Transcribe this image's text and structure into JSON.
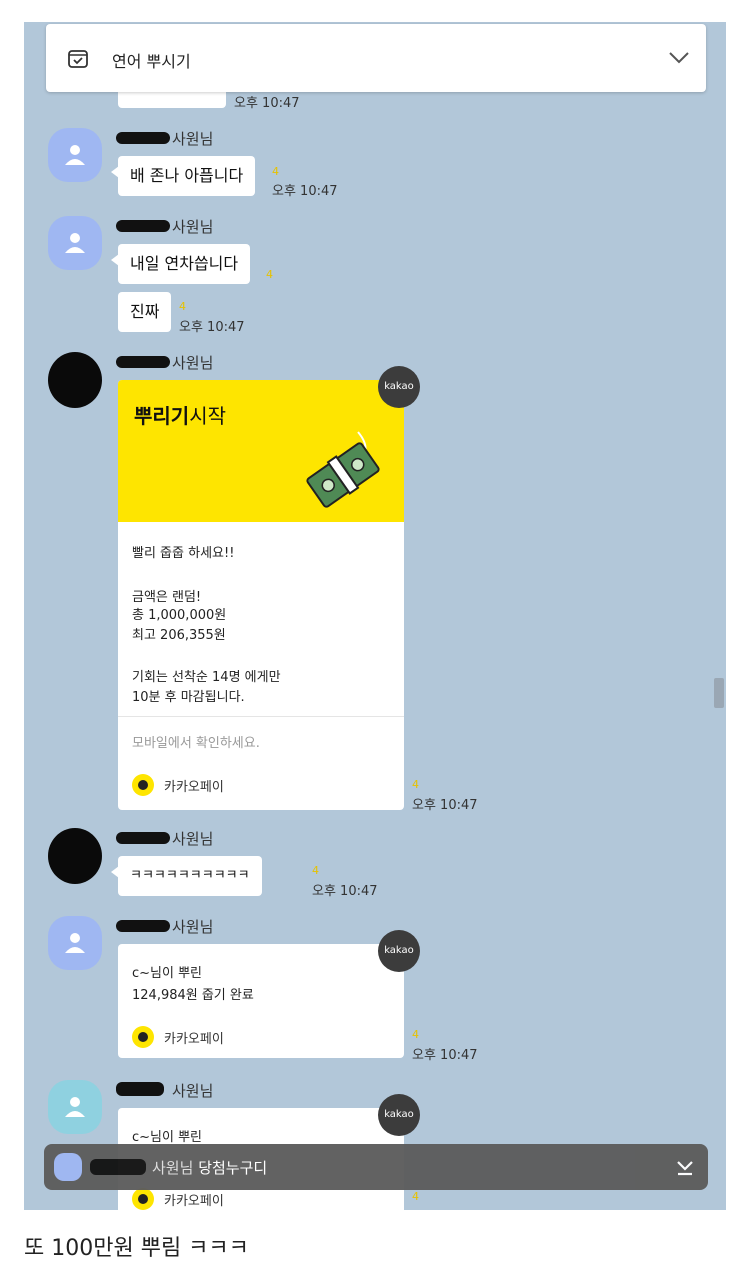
{
  "header": {
    "title": "연어 뿌시기"
  },
  "messages": {
    "m0": {
      "time": "오후 10:47"
    },
    "m1": {
      "sender_suffix": "사원님",
      "text": "배 존나 아픕니다",
      "unread": "4",
      "time": "오후 10:47"
    },
    "m2": {
      "sender_suffix": "사원님",
      "text1": "내일 연차씁니다",
      "unread1": "4",
      "text2": "진짜",
      "unread2": "4",
      "time": "오후 10:47"
    },
    "m3": {
      "sender_suffix": "사원님",
      "badge": "kakao",
      "banner_title_bold": "뿌리기",
      "banner_title_rest": "시작",
      "line1": "빨리 줍줍 하세요!!",
      "line2": "금액은 랜덤!",
      "line3": "총 1,000,000원",
      "line4": "최고 206,355원",
      "line5": "기회는 선착순 14명 에게만",
      "line6": "10분 후 마감됩니다.",
      "mobile_note": "모바일에서 확인하세요.",
      "pay_label": "카카오페이",
      "unread": "4",
      "time": "오후 10:47"
    },
    "m4": {
      "sender_suffix": "사원님",
      "text": "ㅋㅋㅋㅋㅋㅋㅋㅋㅋㅋ",
      "unread": "4",
      "time": "오후 10:47"
    },
    "m5": {
      "sender_suffix": "사원님",
      "badge": "kakao",
      "line1": "c~님이 뿌린",
      "line2": "124,984원 줍기 완료",
      "pay_label": "카카오페이",
      "unread": "4",
      "time": "오후 10:47"
    },
    "m6": {
      "sender_suffix": "사원님",
      "badge": "kakao",
      "line1": "c~님이 뿌린",
      "pay_label": "카카오페이",
      "unread": "4"
    }
  },
  "notice_bar": {
    "sender_suffix": "사원님",
    "text": "당첨누구디"
  },
  "caption": "또 100만원 뿌림 ㅋㅋㅋ",
  "colors": {
    "chat_bg": "#b2c7d9",
    "kakao_yellow": "#fee500",
    "bubble": "#ffffff",
    "unread": "#e6c200"
  },
  "icons": [
    "calendar-check-icon",
    "chevron-down-icon",
    "user-icon",
    "money-icon",
    "kakaopay-icon",
    "download-icon"
  ]
}
